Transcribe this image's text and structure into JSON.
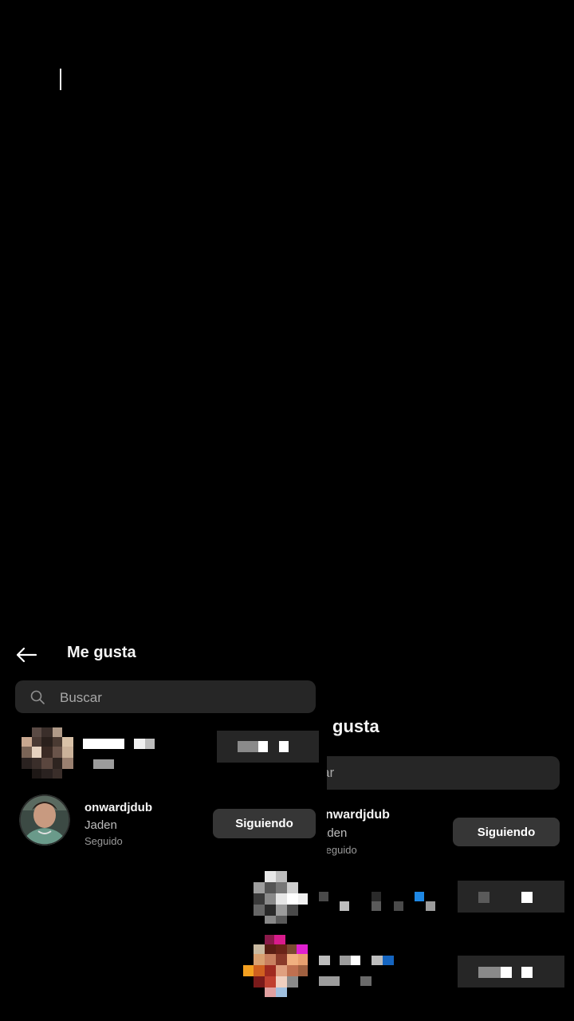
{
  "front_panel": {
    "title": "Me gusta",
    "search": {
      "placeholder": "Buscar",
      "value": ""
    },
    "users": [
      {
        "username": "",
        "full_name": "",
        "status": "",
        "follow_label": "",
        "pixelated": true
      },
      {
        "username": "onwardjdub",
        "full_name": "Jaden",
        "status": "Seguido",
        "follow_label": "Siguiendo",
        "pixelated": false
      }
    ]
  },
  "back_panel": {
    "title": "gusta",
    "search_text": "ar",
    "user": {
      "username": "nwardjdub",
      "full_name": "aden",
      "status": "Seguido",
      "follow_label": "Siguiendo"
    }
  },
  "colors": {
    "background": "#000000",
    "search_field": "#262626",
    "button": "#363636",
    "text_primary": "#f5f5f5",
    "text_secondary": "#a8a8a8"
  },
  "icons": [
    "text-caret",
    "back-arrow-icon",
    "search-icon"
  ]
}
